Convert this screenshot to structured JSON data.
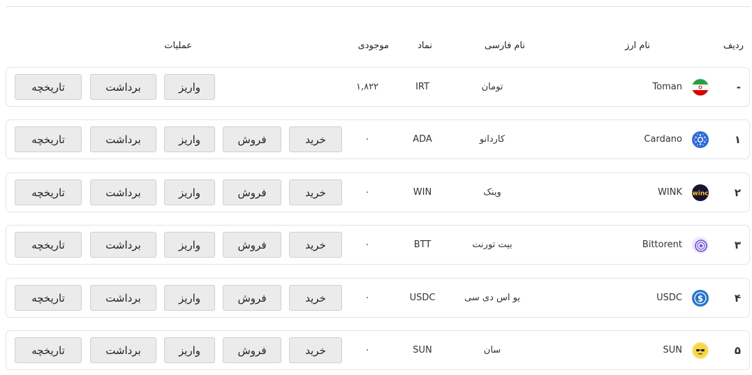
{
  "headers": {
    "row_no": "ردیف",
    "currency_name": "نام ارز",
    "persian_name": "نام فارسی",
    "symbol": "نماد",
    "balance": "موجودی",
    "operations": "عملیات"
  },
  "actions": {
    "buy": "خرید",
    "sell": "فروش",
    "deposit": "واریز",
    "withdraw": "برداشت",
    "history": "تاریخچه"
  },
  "rows": [
    {
      "no": "-",
      "name": "Toman",
      "fa_name": "تومان",
      "symbol": "IRT",
      "balance": "۱,۸۲۲",
      "icon": "iran-flag-icon",
      "tradable": false
    },
    {
      "no": "۱",
      "name": "Cardano",
      "fa_name": "کاردانو",
      "symbol": "ADA",
      "balance": "۰",
      "icon": "cardano-icon",
      "tradable": true
    },
    {
      "no": "۲",
      "name": "WINK",
      "fa_name": "وینک",
      "symbol": "WIN",
      "balance": "۰",
      "icon": "wink-icon",
      "tradable": true
    },
    {
      "no": "۳",
      "name": "Bittorent",
      "fa_name": "بیت تورنت",
      "symbol": "BTT",
      "balance": "۰",
      "icon": "bittorrent-icon",
      "tradable": true
    },
    {
      "no": "۴",
      "name": "USDC",
      "fa_name": "یو اس دی سی",
      "symbol": "USDC",
      "balance": "۰",
      "icon": "usdc-icon",
      "tradable": true
    },
    {
      "no": "۵",
      "name": "SUN",
      "fa_name": "سان",
      "symbol": "SUN",
      "balance": "۰",
      "icon": "sun-token-icon",
      "tradable": true
    }
  ],
  "colors": {
    "button_bg": "#ebebeb",
    "button_border": "#cfcfcf",
    "row_border": "#e4e4e4",
    "cardano": "#2f6ad8",
    "usdc": "#2775ca",
    "bittorrent": "#6a4fd0",
    "sun": "#f7d54a"
  }
}
